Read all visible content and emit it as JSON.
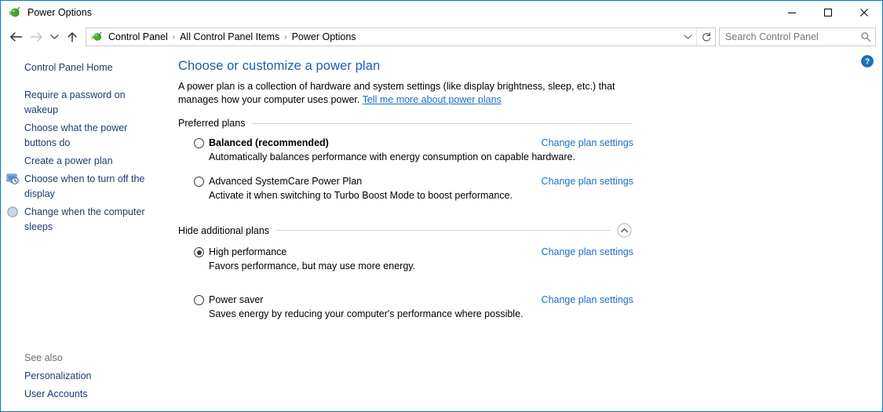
{
  "window": {
    "title": "Power Options",
    "app_icon": "power-plug-icon",
    "minimize_label": "Minimize",
    "maximize_label": "Maximize",
    "close_label": "Close"
  },
  "nav": {
    "back_label": "Back",
    "forward_label": "Forward",
    "recent_label": "Recent locations",
    "up_label": "Up",
    "address_icon": "power-plug-icon",
    "breadcrumbs": [
      "Control Panel",
      "All Control Panel Items",
      "Power Options"
    ],
    "separator": "›",
    "dropdown_label": "Previous locations",
    "refresh_label": "Refresh"
  },
  "search": {
    "placeholder": "Search Control Panel",
    "value": "",
    "icon": "search-icon"
  },
  "sidebar": {
    "home_label": "Control Panel Home",
    "items": [
      {
        "label": "Require a password on wakeup",
        "icon": null
      },
      {
        "label": "Choose what the power buttons do",
        "icon": null
      },
      {
        "label": "Create a power plan",
        "icon": null
      },
      {
        "label": "Choose when to turn off the display",
        "icon": "monitor-clock-icon"
      },
      {
        "label": "Change when the computer sleeps",
        "icon": "moon-icon"
      }
    ],
    "see_also": {
      "title": "See also",
      "links": [
        "Personalization",
        "User Accounts"
      ]
    }
  },
  "main": {
    "help_label": "Help",
    "title": "Choose or customize a power plan",
    "description_before_link": "A power plan is a collection of hardware and system settings (like display brightness, sleep, etc.) that manages how your computer uses power. ",
    "description_link": "Tell me more about power plans",
    "preferred_section": {
      "label": "Preferred plans",
      "plans": [
        {
          "name": "Balanced (recommended)",
          "bold": true,
          "selected": false,
          "description": "Automatically balances performance with energy consumption on capable hardware.",
          "link": "Change plan settings"
        },
        {
          "name": "Advanced SystemCare Power Plan",
          "bold": false,
          "selected": false,
          "description": "Activate it when switching to Turbo Boost Mode to boost performance.",
          "link": "Change plan settings"
        }
      ]
    },
    "additional_section": {
      "label": "Hide additional plans",
      "collapse_icon": "chevron-up-circle-icon",
      "plans": [
        {
          "name": "High performance",
          "bold": false,
          "selected": true,
          "description": "Favors performance, but may use more energy.",
          "link": "Change plan settings"
        },
        {
          "name": "Power saver",
          "bold": false,
          "selected": false,
          "description": "Saves energy by reducing your computer's performance where possible.",
          "link": "Change plan settings"
        }
      ]
    }
  },
  "colors": {
    "window_border": "#0078d7",
    "title_blue": "#1a5fb4",
    "link_blue": "#1a6fc4",
    "sidebar_link": "#1f3c70",
    "muted_text": "#6d6d6d",
    "help_badge": "#1a73c4"
  }
}
